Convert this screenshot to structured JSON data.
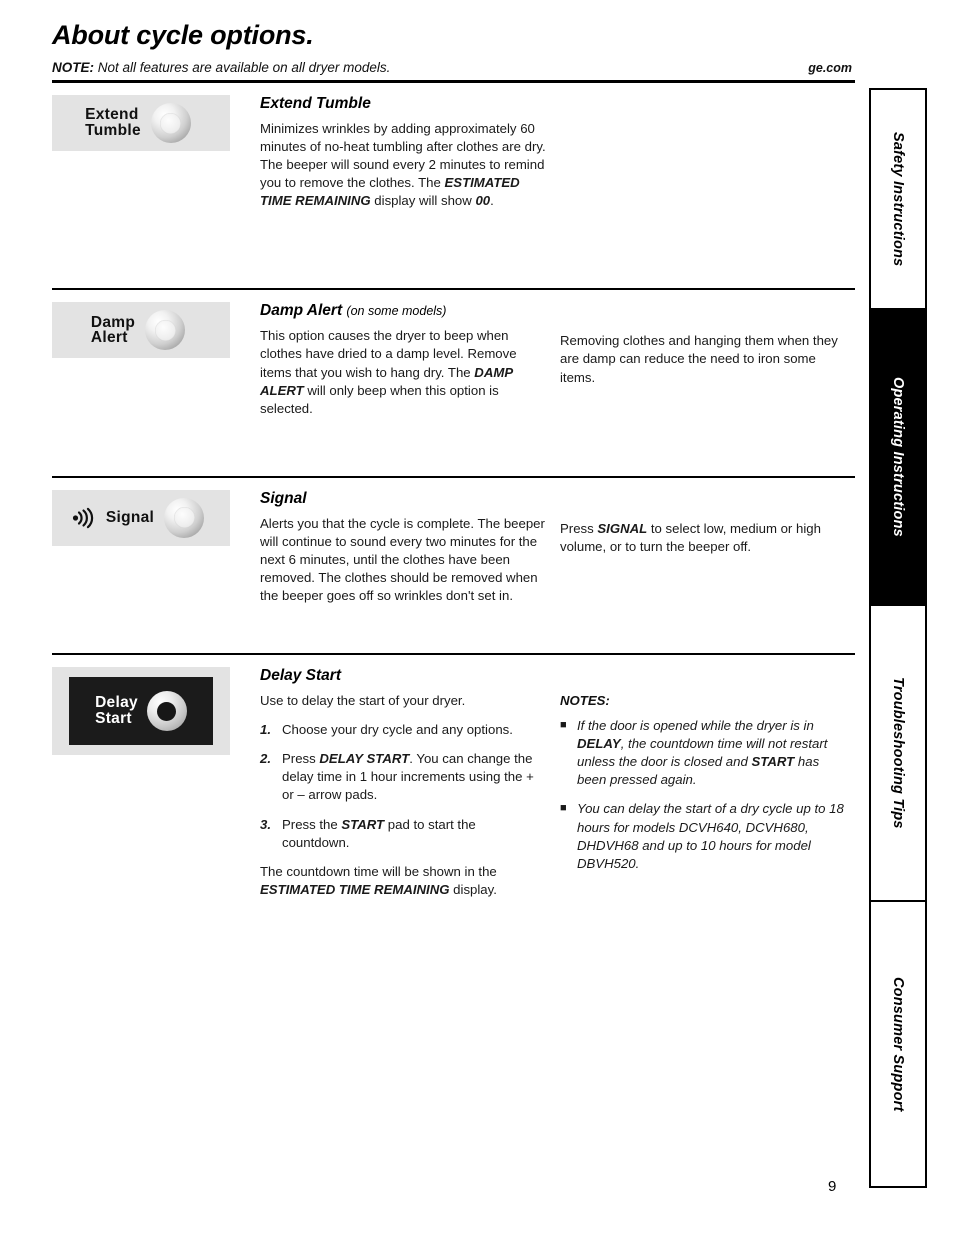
{
  "header": {
    "title": "About cycle options.",
    "note_label": "NOTE:",
    "note_text": " Not all features are available on all dryer models.",
    "website": "ge.com"
  },
  "sections": [
    {
      "control": {
        "line1": "Extend",
        "line2": "Tumble",
        "style": "light",
        "icon": "knob-icon"
      },
      "heading": "Extend Tumble",
      "subheading": "",
      "body_pre": "Minimizes wrinkles by adding approximately 60 minutes of no-heat tumbling after clothes are dry. The beeper will sound every 2 minutes to remind you to remove the clothes. The ",
      "body_bold": "ESTIMATED TIME REMAINING",
      "body_mid": " display will show ",
      "body_bold2": "00",
      "body_post": ".",
      "aside": ""
    },
    {
      "control": {
        "line1": "Damp",
        "line2": "Alert",
        "style": "light",
        "icon": "knob-icon"
      },
      "heading": "Damp Alert",
      "subheading": "(on some models)",
      "body_pre": "This option causes the dryer to beep when clothes have dried to a damp level. Remove items that you wish to hang dry. The ",
      "body_bold": "DAMP ALERT",
      "body_mid": " will only beep when this option is selected.",
      "body_bold2": "",
      "body_post": "",
      "aside": "Removing clothes and hanging them when they are damp can reduce the need to iron some items."
    },
    {
      "control": {
        "line1": "Signal",
        "line2": "",
        "style": "light-wave",
        "icon": "sound-wave-icon"
      },
      "heading": "Signal",
      "subheading": "",
      "body_pre": "Alerts you that the cycle is complete. The beeper will continue to sound every two minutes for the next 6 minutes, until the clothes have been removed. The clothes should be removed when the beeper goes off so wrinkles don't set in.",
      "body_bold": "",
      "body_mid": "",
      "body_bold2": "",
      "body_post": "",
      "aside_pre": "Press ",
      "aside_bold": "SIGNAL",
      "aside_post": " to select low, medium or high volume, or to turn the beeper off."
    },
    {
      "control": {
        "line1": "Delay",
        "line2": "Start",
        "style": "dark",
        "icon": "knob-icon"
      },
      "heading": "Delay Start",
      "intro": "Use to delay the start of your dryer.",
      "steps": [
        {
          "num": "1.",
          "pre": "Choose your dry cycle and any options.",
          "bold": "",
          "post": ""
        },
        {
          "num": "2.",
          "pre": "Press ",
          "bold": "DELAY START",
          "post": ". You can change the delay time in 1 hour increments using the + or – arrow pads."
        },
        {
          "num": "3.",
          "pre": "Press the ",
          "bold": "START",
          "post": " pad to start the countdown."
        }
      ],
      "closing_pre": "The countdown time will be shown in the ",
      "closing_bold": "ESTIMATED TIME REMAINING",
      "closing_post": " display."
    }
  ],
  "notes": {
    "title": "NOTES:",
    "bullet_glyph": "■",
    "items": [
      {
        "pre": "If the door is opened while the dryer is in ",
        "bold": "DELAY",
        "mid": ", the countdown time will not restart unless the door is closed and ",
        "bold2": "START",
        "post": " has been pressed again."
      },
      {
        "pre": "You can delay the start of a dry cycle up to 18 hours for models DCVH640, DCVH680, DHDVH68 and up to 10 hours for model DBVH520.",
        "bold": "",
        "mid": "",
        "bold2": "",
        "post": ""
      }
    ]
  },
  "tabs": [
    {
      "label": "Safety Instructions",
      "active": false
    },
    {
      "label": "Operating Instructions",
      "active": true
    },
    {
      "label": "Troubleshooting Tips",
      "active": false
    },
    {
      "label": "Consumer Support",
      "active": false
    }
  ],
  "page_number": "9"
}
